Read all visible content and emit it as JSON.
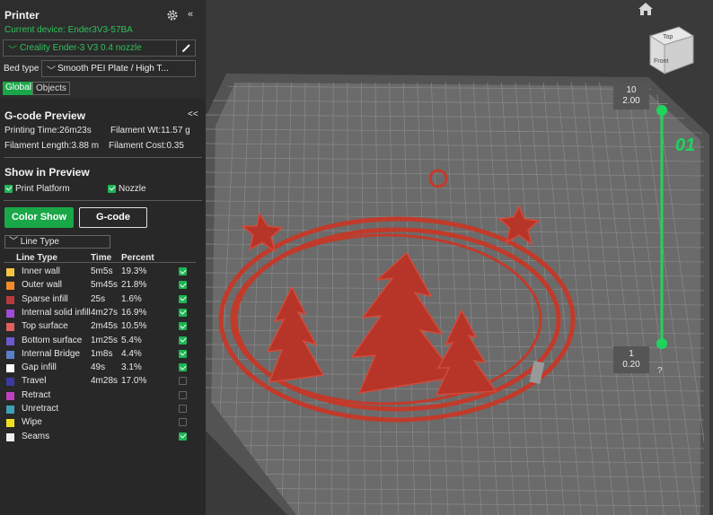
{
  "printer": {
    "title": "Printer",
    "current_device": "Current device: Ender3V3-57BA",
    "nozzle_value": "Creality Ender-3 V3 0.4 nozzle",
    "bed_label": "Bed type",
    "bed_value": "Smooth PEI Plate / High T...",
    "tabs": [
      "Global",
      "Objects"
    ],
    "collapse": "«"
  },
  "gcode": {
    "title": "G-code Preview",
    "collapse": "<<",
    "printing_time": "Printing Time:26m23s",
    "filament_wt": "Filament Wt:11.57 g",
    "filament_length": "Filament Length:3.88 m",
    "filament_cost": "Filament Cost:0.35"
  },
  "show": {
    "title": "Show in Preview",
    "print_platform": "Print Platform",
    "nozzle": "Nozzle"
  },
  "buttons": {
    "color_show": "Color Show",
    "gcode": "G-code"
  },
  "line_type_select": "Line Type",
  "table": {
    "headers": [
      "Line Type",
      "Time",
      "Percent"
    ],
    "rows": [
      {
        "name": "Inner wall",
        "time": "5m5s",
        "pct": "19.3%",
        "color": "#f5c542",
        "checked": true
      },
      {
        "name": "Outer wall",
        "time": "5m45s",
        "pct": "21.8%",
        "color": "#f58a2a",
        "checked": true
      },
      {
        "name": "Sparse infill",
        "time": "25s",
        "pct": "1.6%",
        "color": "#b83a3a",
        "checked": true
      },
      {
        "name": "Internal solid infill",
        "time": "4m27s",
        "pct": "16.9%",
        "color": "#a04ad8",
        "checked": true
      },
      {
        "name": "Top surface",
        "time": "2m45s",
        "pct": "10.5%",
        "color": "#e06060",
        "checked": true
      },
      {
        "name": "Bottom surface",
        "time": "1m25s",
        "pct": "5.4%",
        "color": "#6a5ad0",
        "checked": true
      },
      {
        "name": "Internal Bridge",
        "time": "1m8s",
        "pct": "4.4%",
        "color": "#5a80c8",
        "checked": true
      },
      {
        "name": "Gap infill",
        "time": "49s",
        "pct": "3.1%",
        "color": "#ffffff",
        "checked": true
      },
      {
        "name": "Travel",
        "time": "4m28s",
        "pct": "17.0%",
        "color": "#3a3aa0",
        "checked": false
      },
      {
        "name": "Retract",
        "time": "",
        "pct": "",
        "color": "#c040c0",
        "checked": false
      },
      {
        "name": "Unretract",
        "time": "",
        "pct": "",
        "color": "#40a0b8",
        "checked": false
      },
      {
        "name": "Wipe",
        "time": "",
        "pct": "",
        "color": "#f0e020",
        "checked": false
      },
      {
        "name": "Seams",
        "time": "",
        "pct": "",
        "color": "#f0f0f0",
        "checked": true
      }
    ]
  },
  "slider": {
    "top_layer": "10",
    "top_height": "2.00",
    "bottom_layer": "1",
    "bottom_height": "0.20",
    "plate_number": "01",
    "help": "?"
  },
  "view_cube": {
    "top": "Top",
    "front": "Front"
  },
  "colors": {
    "accent": "#1aa748",
    "model": "#c23a2a"
  }
}
